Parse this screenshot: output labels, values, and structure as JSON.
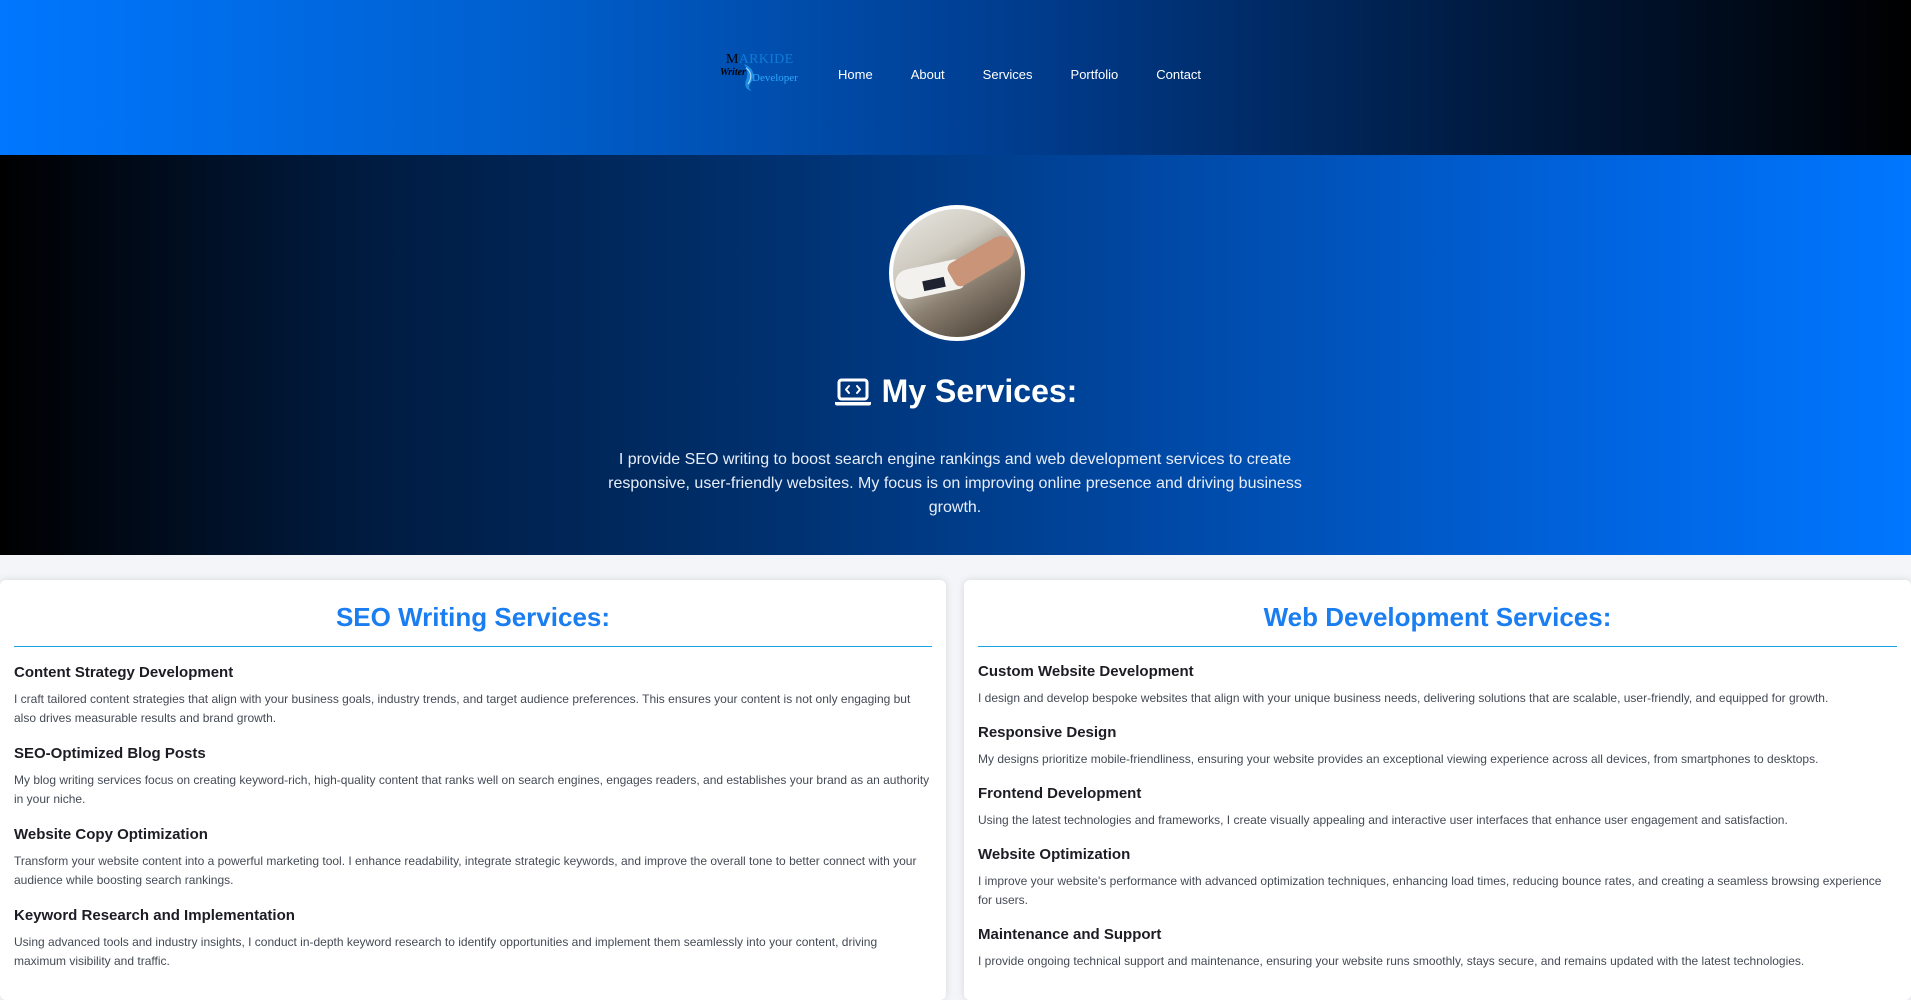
{
  "header": {
    "logo": {
      "top_first": "M",
      "top_rest": "ARKIDE",
      "writer": "Writer",
      "developer": "Developer"
    },
    "nav": [
      "Home",
      "About",
      "Services",
      "Portfolio",
      "Contact"
    ]
  },
  "hero": {
    "title": "My Services:",
    "title_icon": "laptop-code-icon",
    "text": "I provide SEO writing to boost search engine rankings and web development services to create responsive, user-friendly websites. My focus is on improving online presence and driving business growth."
  },
  "seo": {
    "title": "SEO Writing Services:",
    "items": [
      {
        "title": "Content Strategy Development",
        "text": "I craft tailored content strategies that align with your business goals, industry trends, and target audience preferences. This ensures your content is not only engaging but also drives measurable results and brand growth."
      },
      {
        "title": "SEO-Optimized Blog Posts",
        "text": "My blog writing services focus on creating keyword-rich, high-quality content that ranks well on search engines, engages readers, and establishes your brand as an authority in your niche."
      },
      {
        "title": "Website Copy Optimization",
        "text": "Transform your website content into a powerful marketing tool. I enhance readability, integrate strategic keywords, and improve the overall tone to better connect with your audience while boosting search rankings."
      },
      {
        "title": "Keyword Research and Implementation",
        "text": "Using advanced tools and industry insights, I conduct in-depth keyword research to identify opportunities and implement them seamlessly into your content, driving maximum visibility and traffic."
      }
    ]
  },
  "web": {
    "title": "Web Development Services:",
    "items": [
      {
        "title": "Custom Website Development",
        "text": "I design and develop bespoke websites that align with your unique business needs, delivering solutions that are scalable, user-friendly, and equipped for growth."
      },
      {
        "title": "Responsive Design",
        "text": "My designs prioritize mobile-friendliness, ensuring your website provides an exceptional viewing experience across all devices, from smartphones to desktops."
      },
      {
        "title": "Frontend Development",
        "text": "Using the latest technologies and frameworks, I create visually appealing and interactive user interfaces that enhance user engagement and satisfaction."
      },
      {
        "title": "Website Optimization",
        "text": "I improve your website's performance with advanced optimization techniques, enhancing load times, reducing bounce rates, and creating a seamless browsing experience for users."
      },
      {
        "title": "Maintenance and Support",
        "text": "I provide ongoing technical support and maintenance, ensuring your website runs smoothly, stays secure, and remains updated with the latest technologies."
      }
    ]
  },
  "colors": {
    "accent": "#1a7ef0",
    "rule": "#1aa3e8",
    "header_start": "#0077ff",
    "header_end": "#000000"
  }
}
